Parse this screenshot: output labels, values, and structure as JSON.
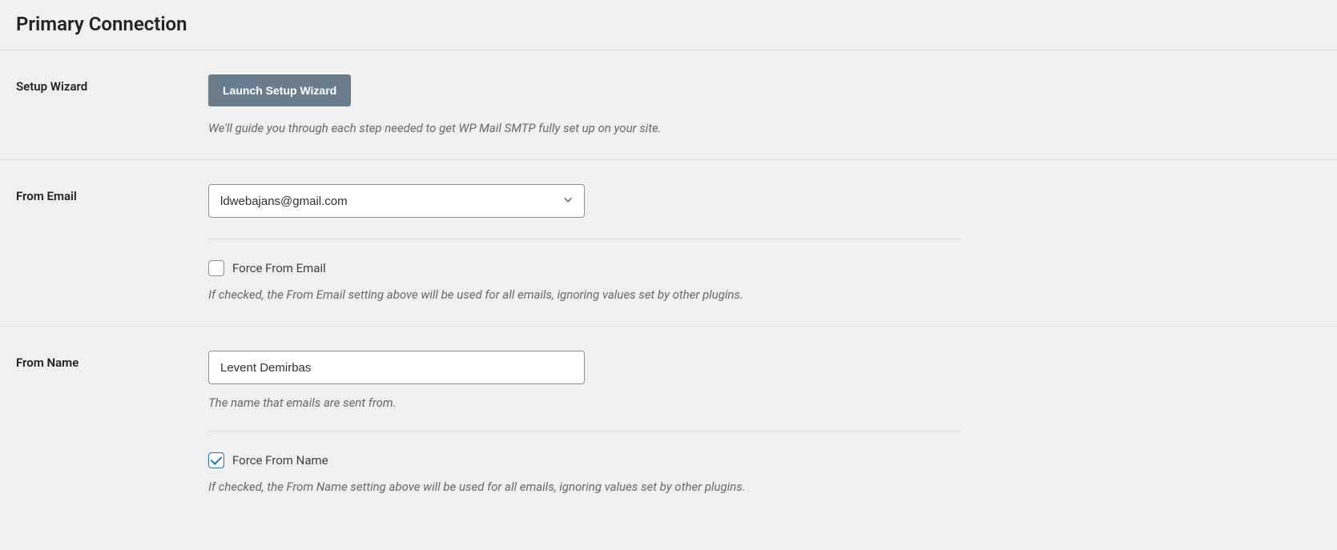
{
  "page": {
    "title": "Primary Connection"
  },
  "setup_wizard": {
    "label": "Setup Wizard",
    "button": "Launch Setup Wizard",
    "description": "We'll guide you through each step needed to get WP Mail SMTP fully set up on your site."
  },
  "from_email": {
    "label": "From Email",
    "value": "ldwebajans@gmail.com",
    "force_label": "Force From Email",
    "force_checked": false,
    "force_description": "If checked, the From Email setting above will be used for all emails, ignoring values set by other plugins."
  },
  "from_name": {
    "label": "From Name",
    "value": "Levent Demirbas",
    "description": "The name that emails are sent from.",
    "force_label": "Force From Name",
    "force_checked": true,
    "force_description": "If checked, the From Name setting above will be used for all emails, ignoring values set by other plugins."
  }
}
